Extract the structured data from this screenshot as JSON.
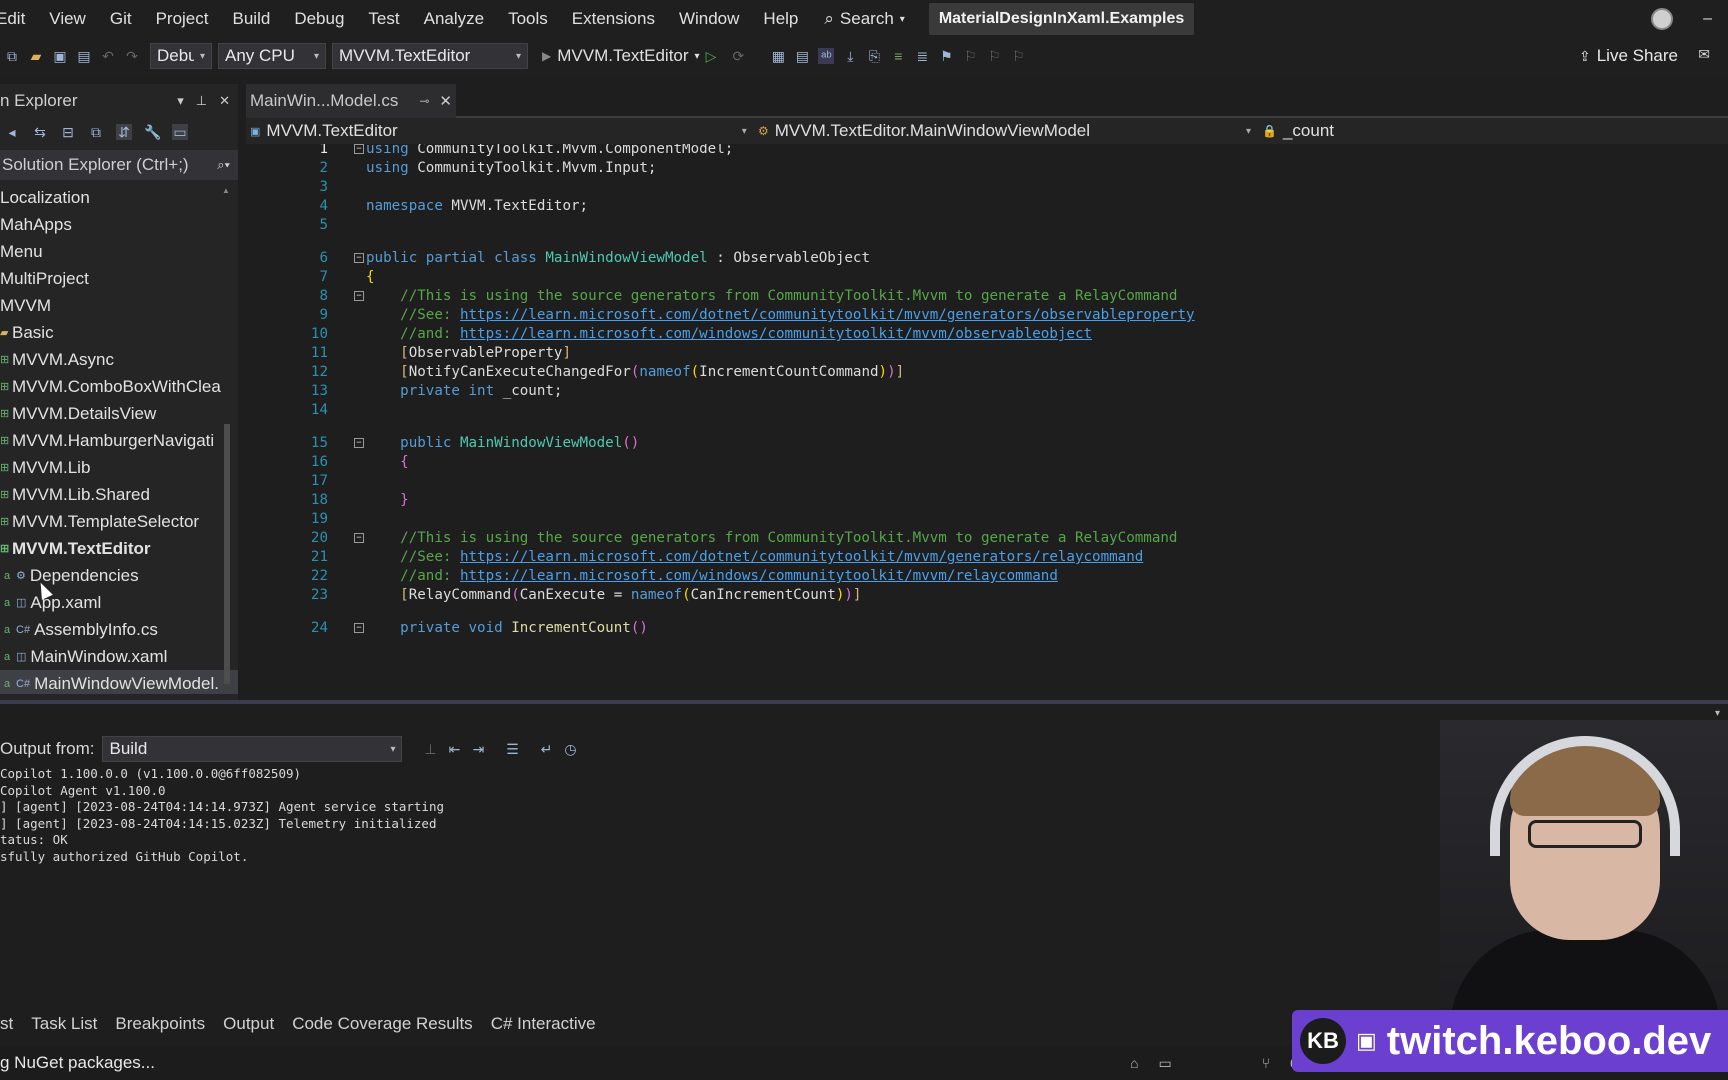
{
  "menubar": {
    "items": [
      "Edit",
      "View",
      "Git",
      "Project",
      "Build",
      "Debug",
      "Test",
      "Analyze",
      "Tools",
      "Extensions",
      "Window",
      "Help"
    ],
    "search_label": "Search",
    "solution_name": "MaterialDesignInXaml.Examples"
  },
  "toolbar": {
    "config": "Debug",
    "platform": "Any CPU",
    "startup_project": "MVVM.TextEditor",
    "run_target": "MVVM.TextEditor",
    "live_share": "Live Share"
  },
  "solution_explorer": {
    "title": "n Explorer",
    "search_placeholder": "Solution Explorer (Ctrl+;)",
    "items": [
      {
        "label": "Localization",
        "type": "folder",
        "indent": 0,
        "bold": false
      },
      {
        "label": "MahApps",
        "type": "folder",
        "indent": 0,
        "bold": false
      },
      {
        "label": "Menu",
        "type": "folder",
        "indent": 0,
        "bold": false
      },
      {
        "label": "MultiProject",
        "type": "folder",
        "indent": 0,
        "bold": false
      },
      {
        "label": "MVVM",
        "type": "folder",
        "indent": 0,
        "bold": false
      },
      {
        "label": "Basic",
        "type": "folder",
        "indent": 1,
        "bold": false
      },
      {
        "label": "MVVM.Async",
        "type": "project",
        "indent": 1,
        "bold": false
      },
      {
        "label": "MVVM.ComboBoxWithClea",
        "type": "project",
        "indent": 1,
        "bold": false
      },
      {
        "label": "MVVM.DetailsView",
        "type": "project",
        "indent": 1,
        "bold": false
      },
      {
        "label": "MVVM.HamburgerNavigati",
        "type": "project",
        "indent": 1,
        "bold": false
      },
      {
        "label": "MVVM.Lib",
        "type": "project",
        "indent": 1,
        "bold": false
      },
      {
        "label": "MVVM.Lib.Shared",
        "type": "project",
        "indent": 1,
        "bold": false
      },
      {
        "label": "MVVM.TemplateSelector",
        "type": "project",
        "indent": 1,
        "bold": false
      },
      {
        "label": "MVVM.TextEditor",
        "type": "project",
        "indent": 1,
        "bold": true
      },
      {
        "label": "Dependencies",
        "type": "deps",
        "indent": 2,
        "bold": false
      },
      {
        "label": "App.xaml",
        "type": "xaml",
        "indent": 2,
        "bold": false
      },
      {
        "label": "AssemblyInfo.cs",
        "type": "cs",
        "indent": 2,
        "bold": false
      },
      {
        "label": "MainWindow.xaml",
        "type": "xaml",
        "indent": 2,
        "bold": false
      },
      {
        "label": "MainWindowViewModel.",
        "type": "cs",
        "indent": 2,
        "bold": false,
        "selected": true
      }
    ]
  },
  "editor": {
    "tab_title": "MainWin...Model.cs",
    "nav_project": "MVVM.TextEditor",
    "nav_class": "MVVM.TextEditor.MainWindowViewModel",
    "nav_member": "_count"
  },
  "code_lines": [
    {
      "n": "1",
      "html": "<span class='kw'>using</span> <span class='id'>CommunityToolkit.Mvvm.ComponentModel;</span>",
      "fold": "-"
    },
    {
      "n": "2",
      "html": "<span class='kw'>using</span> <span class='id'>CommunityToolkit.Mvvm.Input;</span>",
      "fold": ""
    },
    {
      "n": "3",
      "html": "",
      "fold": ""
    },
    {
      "n": "4",
      "html": "<span class='kw'>namespace</span> <span class='id'>MVVM.TextEditor;</span>",
      "fold": ""
    },
    {
      "n": "5",
      "html": "",
      "fold": ""
    },
    {
      "n": "6",
      "html": "<span class='kw'>public partial class</span> <span class='ty'>MainWindowViewModel</span> <span class='id'>: ObservableObject</span>",
      "fold": "-"
    },
    {
      "n": "7",
      "html": "<span class='br2'>{</span>",
      "fold": ""
    },
    {
      "n": "8",
      "html": "    <span class='cm'>//This is using the source generators from CommunityToolkit.Mvvm to generate a RelayCommand</span>",
      "fold": "-"
    },
    {
      "n": "9",
      "html": "    <span class='cm'>//See: </span><span class='lk'>https://learn.microsoft.com/dotnet/communitytoolkit/mvvm/generators/observableproperty</span>",
      "fold": ""
    },
    {
      "n": "10",
      "html": "    <span class='cm'>//and: </span><span class='lk'>https://learn.microsoft.com/windows/communitytoolkit/mvvm/observableobject</span>",
      "fold": ""
    },
    {
      "n": "11",
      "html": "    <span class='at'>[</span><span class='id'>ObservableProperty</span><span class='at'>]</span>",
      "fold": ""
    },
    {
      "n": "12",
      "html": "    <span class='at'>[</span><span class='id'>NotifyCanExecuteChangedFor</span><span class='br'>(</span><span class='kw'>nameof</span><span class='br2'>(</span><span class='id'>IncrementCountCommand</span><span class='br2'>)</span><span class='br'>)</span><span class='at'>]</span>",
      "fold": ""
    },
    {
      "n": "13",
      "html": "    <span class='kw'>private int</span> <span class='id'>_count;</span>",
      "fold": ""
    },
    {
      "n": "14",
      "html": "",
      "fold": ""
    },
    {
      "n": "15",
      "html": "    <span class='kw'>public</span> <span class='ty'>MainWindowViewModel</span><span class='br'>()</span>",
      "fold": "-"
    },
    {
      "n": "16",
      "html": "    <span class='br'>{</span>",
      "fold": ""
    },
    {
      "n": "17",
      "html": "",
      "fold": ""
    },
    {
      "n": "18",
      "html": "    <span class='br'>}</span>",
      "fold": ""
    },
    {
      "n": "19",
      "html": "",
      "fold": ""
    },
    {
      "n": "20",
      "html": "    <span class='cm'>//This is using the source generators from CommunityToolkit.Mvvm to generate a RelayCommand</span>",
      "fold": "-"
    },
    {
      "n": "21",
      "html": "    <span class='cm'>//See: </span><span class='lk'>https://learn.microsoft.com/dotnet/communitytoolkit/mvvm/generators/relaycommand</span>",
      "fold": ""
    },
    {
      "n": "22",
      "html": "    <span class='cm'>//and: </span><span class='lk'>https://learn.microsoft.com/windows/communitytoolkit/mvvm/relaycommand</span>",
      "fold": ""
    },
    {
      "n": "23",
      "html": "    <span class='at'>[</span><span class='id'>RelayCommand</span><span class='br'>(</span><span class='id'>CanExecute = </span><span class='kw'>nameof</span><span class='br2'>(</span><span class='id'>CanIncrementCount</span><span class='br2'>)</span><span class='br'>)</span><span class='at'>]</span>",
      "fold": ""
    },
    {
      "n": "24",
      "html": "    <span class='kw'>private void</span> <span class='fn'>IncrementCount</span><span class='br'>()</span>",
      "fold": "-"
    }
  ],
  "output": {
    "label": "Output from:",
    "source": "Build",
    "lines": [
      "Copilot 1.100.0.0 (v1.100.0.0@6ff082509)",
      "Copilot Agent v1.100.0",
      "] [agent] [2023-08-24T04:14:14.973Z] Agent service starting",
      "] [agent] [2023-08-24T04:14:15.023Z] Telemetry initialized",
      "tatus: OK",
      "sfully authorized GitHub Copilot."
    ]
  },
  "bottom_tabs": [
    "st",
    "Task List",
    "Breakpoints",
    "Output",
    "Code Coverage Results",
    "C# Interactive"
  ],
  "status": {
    "left": "g NuGet packages...",
    "branch_count": "0"
  },
  "overlay": {
    "logo": "KB",
    "url": "twitch.keboo.dev"
  }
}
